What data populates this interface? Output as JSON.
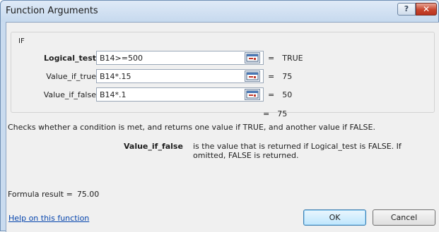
{
  "window": {
    "title": "Function Arguments",
    "help_glyph": "?",
    "close_glyph": "✕"
  },
  "function_group": {
    "name": "IF",
    "args": [
      {
        "label": "Logical_test",
        "bold": true,
        "value": "B14>=500",
        "result": "TRUE"
      },
      {
        "label": "Value_if_true",
        "bold": false,
        "value": "B14*.15",
        "result": "75"
      },
      {
        "label": "Value_if_false",
        "bold": false,
        "value": "B14*.1",
        "result": "50"
      }
    ],
    "equals": "="
  },
  "result": {
    "equals": "=",
    "value": "75"
  },
  "description": "Checks whether a condition is met, and returns one value if TRUE, and another value if FALSE.",
  "arg_help": {
    "name": "Value_if_false",
    "text": "is the value that is returned if Logical_test is FALSE. If omitted, FALSE is returned."
  },
  "formula_result": {
    "label": "Formula result =",
    "value": "75.00"
  },
  "help_link": "Help on this function",
  "buttons": {
    "ok": "OK",
    "cancel": "Cancel"
  },
  "icons": {
    "collapse": "collapse-dialog-icon",
    "help": "question-mark-icon",
    "close": "close-icon"
  },
  "colors": {
    "titlebar": "#c6d9ee",
    "close_button": "#c8452d",
    "link": "#0645ad"
  }
}
